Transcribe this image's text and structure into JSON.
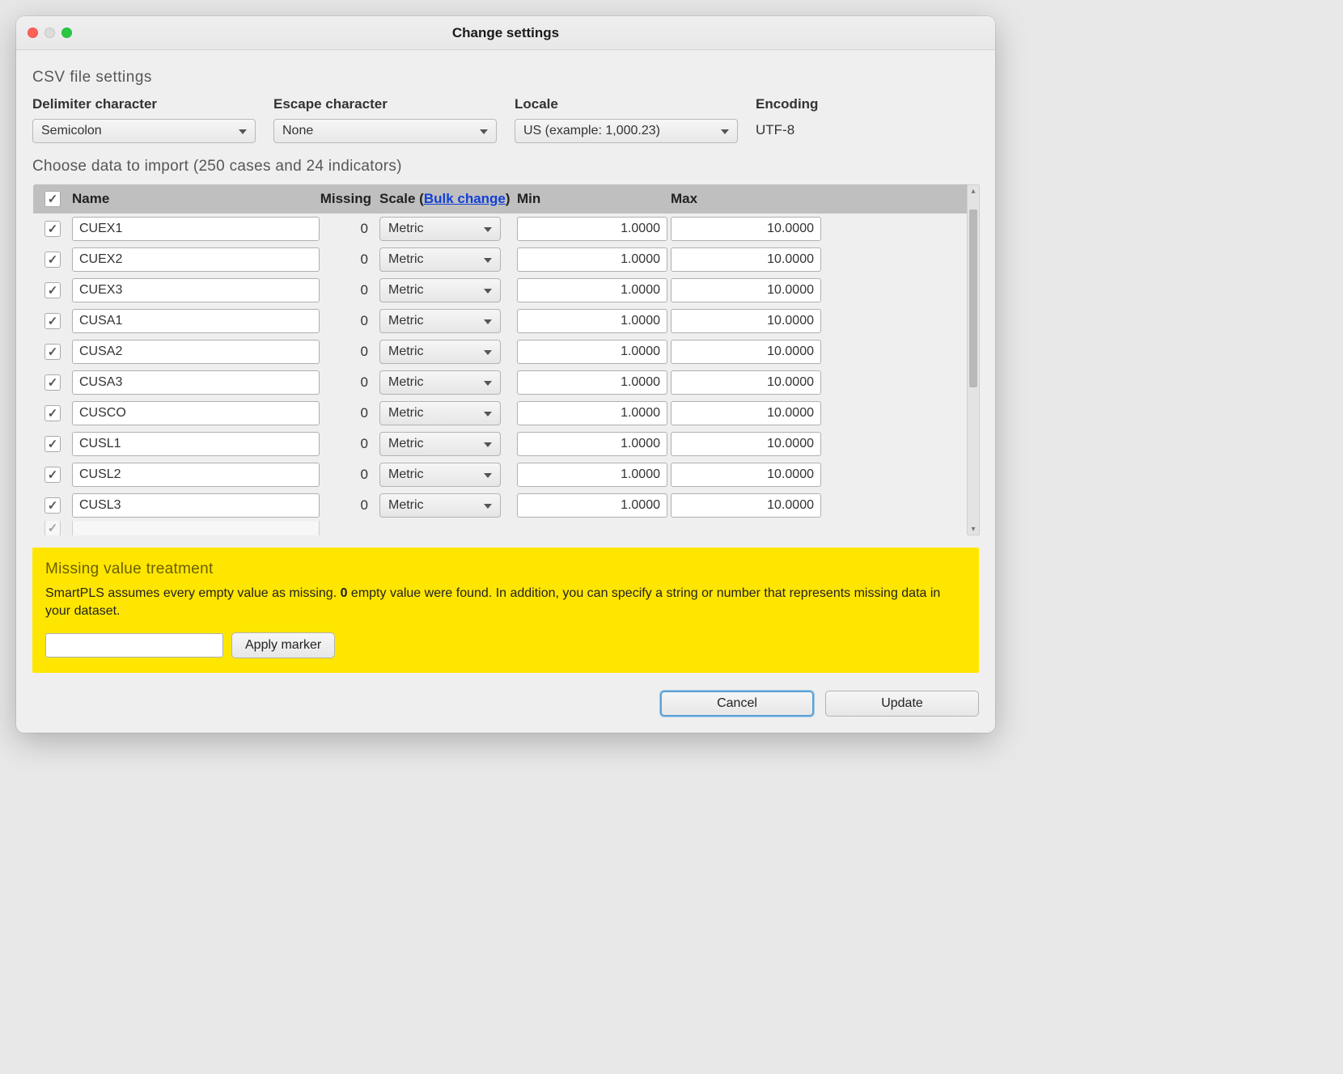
{
  "window": {
    "title": "Change settings"
  },
  "sections": {
    "csv_title": "CSV file settings",
    "delimiter_label": "Delimiter character",
    "delimiter_value": "Semicolon",
    "escape_label": "Escape character",
    "escape_value": "None",
    "locale_label": "Locale",
    "locale_value": "US (example: 1,000.23)",
    "encoding_label": "Encoding",
    "encoding_value": "UTF-8",
    "import_line": "Choose data to import (250 cases and 24 indicators)"
  },
  "table": {
    "header": {
      "name": "Name",
      "missing": "Missing",
      "scale_pre": "Scale (",
      "bulk": "Bulk change",
      "scale_post": ")",
      "min": "Min",
      "max": "Max"
    },
    "rows": [
      {
        "checked": true,
        "name": "CUEX1",
        "missing": "0",
        "scale": "Metric",
        "min": "1.0000",
        "max": "10.0000"
      },
      {
        "checked": true,
        "name": "CUEX2",
        "missing": "0",
        "scale": "Metric",
        "min": "1.0000",
        "max": "10.0000"
      },
      {
        "checked": true,
        "name": "CUEX3",
        "missing": "0",
        "scale": "Metric",
        "min": "1.0000",
        "max": "10.0000"
      },
      {
        "checked": true,
        "name": "CUSA1",
        "missing": "0",
        "scale": "Metric",
        "min": "1.0000",
        "max": "10.0000"
      },
      {
        "checked": true,
        "name": "CUSA2",
        "missing": "0",
        "scale": "Metric",
        "min": "1.0000",
        "max": "10.0000"
      },
      {
        "checked": true,
        "name": "CUSA3",
        "missing": "0",
        "scale": "Metric",
        "min": "1.0000",
        "max": "10.0000"
      },
      {
        "checked": true,
        "name": "CUSCO",
        "missing": "0",
        "scale": "Metric",
        "min": "1.0000",
        "max": "10.0000"
      },
      {
        "checked": true,
        "name": "CUSL1",
        "missing": "0",
        "scale": "Metric",
        "min": "1.0000",
        "max": "10.0000"
      },
      {
        "checked": true,
        "name": "CUSL2",
        "missing": "0",
        "scale": "Metric",
        "min": "1.0000",
        "max": "10.0000"
      },
      {
        "checked": true,
        "name": "CUSL3",
        "missing": "0",
        "scale": "Metric",
        "min": "1.0000",
        "max": "10.0000"
      }
    ]
  },
  "missing_box": {
    "title": "Missing value treatment",
    "text_pre": "SmartPLS assumes every empty value as missing. ",
    "text_bold": "0",
    "text_post": " empty value were found. In addition, you can specify a string or number that represents missing data in your dataset.",
    "marker_value": "",
    "apply_label": "Apply marker"
  },
  "footer": {
    "cancel": "Cancel",
    "update": "Update"
  }
}
